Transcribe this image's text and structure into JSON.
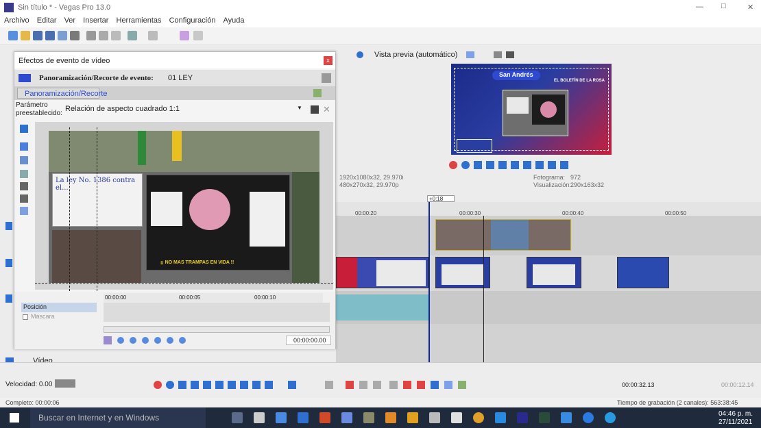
{
  "window": {
    "title": "Sin título * - Vegas Pro 13.0",
    "minimize": "—",
    "maximize": "□",
    "close": "✕"
  },
  "menu": [
    "Archivo",
    "Editar",
    "Ver",
    "Insertar",
    "Herramientas",
    "Configuración",
    "Ayuda"
  ],
  "preview": {
    "mode_label": "Vista previa (automático)",
    "overlay_brand": "San Andrés",
    "overlay_banner": "EL BOLETÍN DE LA ROSA",
    "project_res": "1920x1080x32, 29.970i",
    "preview_res": "480x270x32, 29.970p",
    "frame_label": "Fotograma:",
    "frame_value": "972",
    "display_label": "Visualización:",
    "display_value": "290x163x32"
  },
  "dialog": {
    "title": "Efectos de evento de vídeo",
    "header_label": "Panoramización/Recorte de evento:",
    "header_event": "01 LEY",
    "tab_label": "Panoramización/Recorte",
    "preset_label_1": "Parámetro",
    "preset_label_2": "preestablecido:",
    "preset_value": "Relación de aspecto cuadrado 1:1",
    "time_0": "00:00:00",
    "time_5": "00:00:05",
    "time_10": "00:00:10",
    "prop_position": "Posición",
    "prop_mask": "Máscara",
    "timecode": "00:00:00.00",
    "sign_left": "La ley No. 1386 contra el...",
    "sign_right": "¡¡ NO MAS TRAMPAS EN VIDA !!"
  },
  "timeline": {
    "marker": "+0:18",
    "ruler": [
      "00:00:20",
      "00:00:30",
      "00:00:40",
      "00:00:50"
    ],
    "track_label": "Vídeo"
  },
  "bottom": {
    "speed": "Velocidad: 0.00",
    "timecode": "00:00:32.13",
    "timecode_dim": "00:00:12.14"
  },
  "status": {
    "complete": "Completo: 00:00:06",
    "record_time": "Tiempo de grabación (2 canales): 563:38:45"
  },
  "taskbar": {
    "search": "Buscar en Internet y en Windows",
    "time": "04:46 p. m.",
    "date": "27/11/2021"
  },
  "colors": {
    "accent": "#2f6fd0",
    "close_red": "#e04343",
    "taskbar": "#1f2a3d"
  }
}
